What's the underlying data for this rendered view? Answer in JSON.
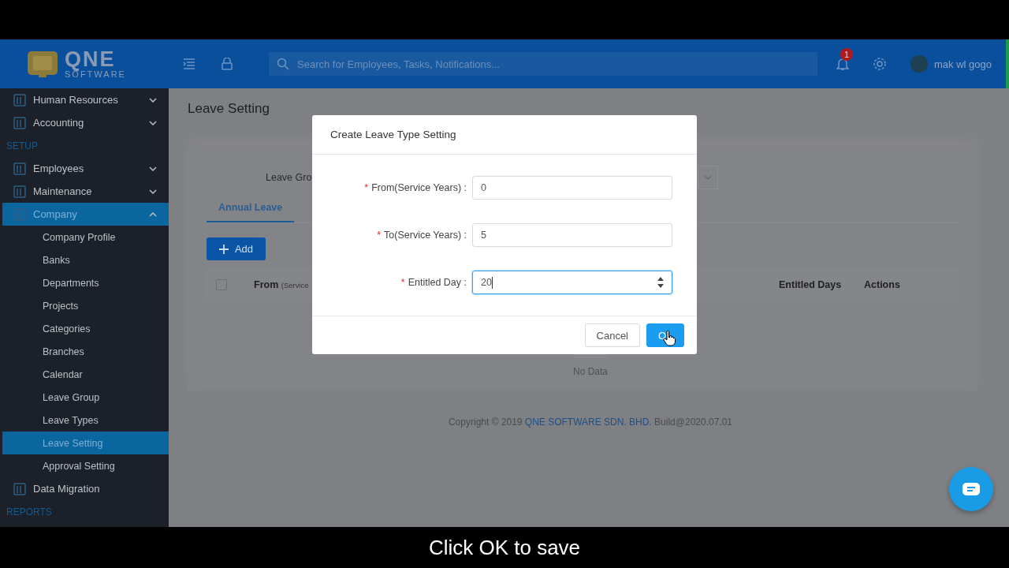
{
  "header": {
    "logo": {
      "name": "QNE",
      "sub": "SOFTWARE"
    },
    "search": {
      "placeholder": "Search for Employees, Tasks, Notifications..."
    },
    "notification_count": "1",
    "user": "mak wl gogo"
  },
  "sidebar": {
    "items": [
      {
        "kind": "item",
        "label": "Human Resources",
        "expanded": false,
        "selected": false
      },
      {
        "kind": "item",
        "label": "Accounting",
        "expanded": false,
        "selected": false
      },
      {
        "kind": "section",
        "label": "SETUP"
      },
      {
        "kind": "item",
        "label": "Employees",
        "expanded": false,
        "selected": false
      },
      {
        "kind": "item",
        "label": "Maintenance",
        "expanded": false,
        "selected": false
      },
      {
        "kind": "item",
        "label": "Company",
        "expanded": true,
        "selected": true,
        "children": [
          {
            "label": "Company Profile",
            "selected": false
          },
          {
            "label": "Banks",
            "selected": false
          },
          {
            "label": "Departments",
            "selected": false
          },
          {
            "label": "Projects",
            "selected": false
          },
          {
            "label": "Categories",
            "selected": false
          },
          {
            "label": "Branches",
            "selected": false
          },
          {
            "label": "Calendar",
            "selected": false
          },
          {
            "label": "Leave Group",
            "selected": false
          },
          {
            "label": "Leave Types",
            "selected": false
          },
          {
            "label": "Leave Setting",
            "selected": true
          },
          {
            "label": "Approval Setting",
            "selected": false
          }
        ]
      },
      {
        "kind": "leaf",
        "label": "Data Migration",
        "selected": false
      },
      {
        "kind": "section",
        "label": "REPORTS"
      }
    ]
  },
  "page": {
    "title": "Leave Setting",
    "leave_group_label": "Leave Gro",
    "tabs": [
      {
        "label": "Annual Leave",
        "selected": true
      }
    ],
    "add_button": "Add",
    "table": {
      "select_all_checked": false,
      "columns": [
        {
          "label": "From",
          "hint": "(Service"
        },
        {
          "label": "Entitled Days"
        },
        {
          "label": "Actions"
        }
      ],
      "empty_text": "No Data"
    }
  },
  "modal": {
    "title": "Create Leave Type Setting",
    "fields": [
      {
        "kind": "text",
        "label": "From(Service Years) :",
        "value": "0",
        "required_mark": "*",
        "focused": false
      },
      {
        "kind": "text",
        "label": "To(Service Years) :",
        "value": "5",
        "required_mark": "*",
        "focused": false
      },
      {
        "kind": "number",
        "label": "Entitled Day :",
        "value": "20",
        "required_mark": "*",
        "focused": true
      }
    ],
    "buttons": [
      {
        "kind": "secondary",
        "label": "Cancel"
      },
      {
        "kind": "primary",
        "label": "O"
      }
    ]
  },
  "footer": {
    "before": "Copyright © 2019",
    "link": "QNE SOFTWARE SDN. BHD.",
    "after": "Build@2020.07.01"
  },
  "caption": "Click OK to save"
}
